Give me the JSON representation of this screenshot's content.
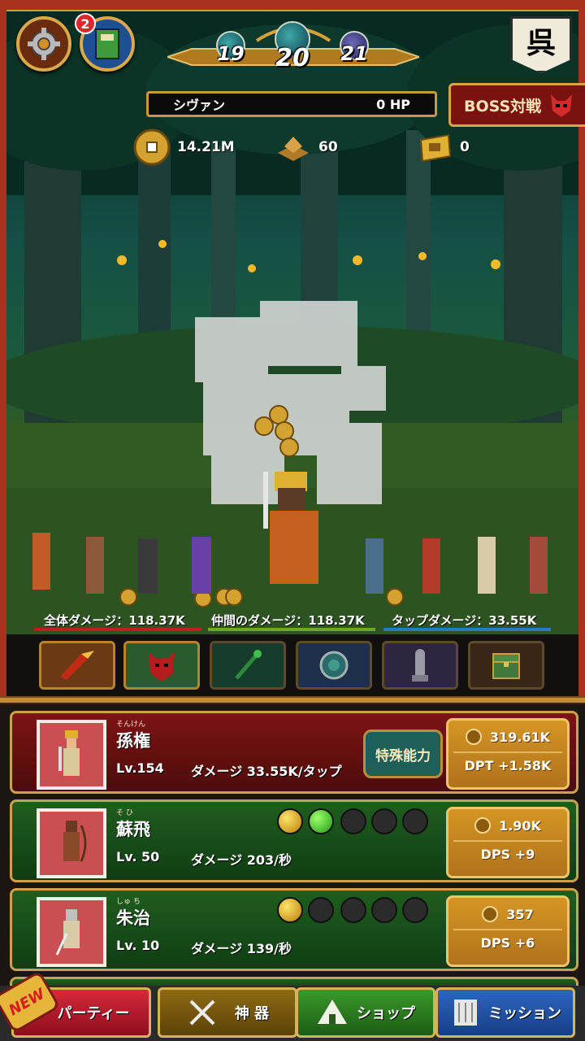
{
  "header": {
    "notification_badge": "2",
    "stages": [
      "19",
      "20",
      "21"
    ],
    "flag_char": "呉"
  },
  "enemy": {
    "name": "シヴァン",
    "hp": "0 HP"
  },
  "boss_button": {
    "label": "BOSS対戦"
  },
  "resources": {
    "coins": "14.21M",
    "ore": "60",
    "tickets": "0"
  },
  "stats": {
    "total_damage": "全体ダメージ：118.37K",
    "ally_damage": "仲間のダメージ：118.37K",
    "tap_damage": "タップダメージ：33.55K"
  },
  "skill_icons": [
    "fire-arrows-icon",
    "demon-mask-icon",
    "jade-staff-icon",
    "orb-mirror-icon",
    "statue-icon",
    "treasure-chest-icon"
  ],
  "heroes": [
    {
      "ruby": "そんけん",
      "name": "孫権",
      "level": "Lv.154",
      "damage": "ダメージ 33.55K/タップ",
      "special": "特殊能力",
      "cost": "319.61K",
      "gain": "DPT +1.58K"
    },
    {
      "ruby": "そ  ひ",
      "name": "蘇飛",
      "level": "Lv. 50",
      "damage": "ダメージ 203/秒",
      "cost": "1.90K",
      "gain": "DPS +9",
      "orbs": [
        "gold",
        "green",
        "empty",
        "empty",
        "empty"
      ]
    },
    {
      "ruby": "しゅ ち",
      "name": "朱治",
      "level": "Lv. 10",
      "damage": "ダメージ 139/秒",
      "cost": "357",
      "gain": "DPS +6",
      "orbs": [
        "gold",
        "empty",
        "empty",
        "empty",
        "empty"
      ]
    }
  ],
  "nav": {
    "new_badge": "NEW",
    "party": "パーティー",
    "artifacts": "神 器",
    "shop": "ショップ",
    "mission": "ミッション"
  },
  "colors": {
    "frame_red": "#a8321e",
    "gold_border": "#caa24c",
    "stat_red": "#c0201c",
    "stat_green": "#6ea82a",
    "stat_blue": "#2a7ac0"
  }
}
